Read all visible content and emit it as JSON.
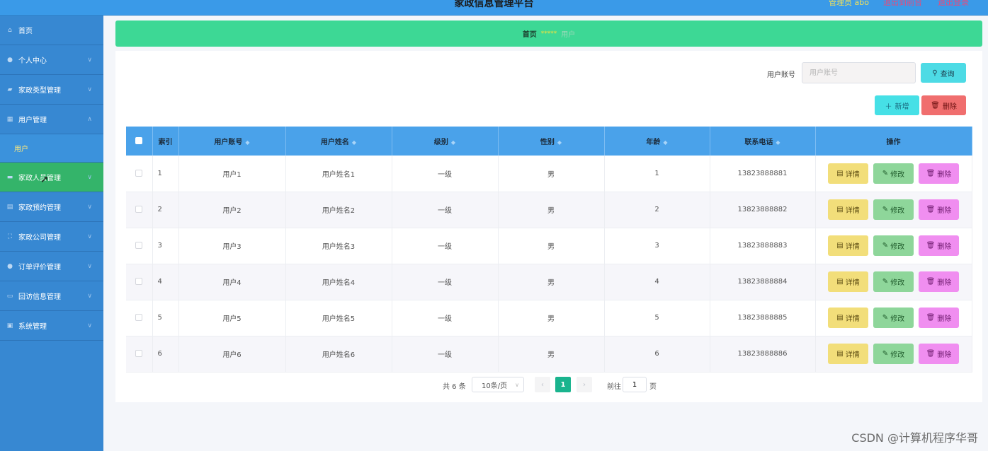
{
  "topbar": {
    "title": "家政信息管理平台",
    "user": "管理员 abo",
    "link_center": "退出到前台",
    "link_logout": "退出登录"
  },
  "sidebar": {
    "items": [
      {
        "label": "首页",
        "icon": "home-icon",
        "chev": false
      },
      {
        "label": "个人中心",
        "icon": "user-icon",
        "chev": true
      },
      {
        "label": "家政类型管理",
        "icon": "thumb-icon",
        "chev": true
      },
      {
        "label": "用户管理",
        "icon": "grid-icon",
        "chev": true,
        "expanded": true
      },
      {
        "label": "家政人员管理",
        "icon": "list-icon",
        "chev": true,
        "active": true
      },
      {
        "label": "家政预约管理",
        "icon": "clipboard-icon",
        "chev": true
      },
      {
        "label": "家政公司管理",
        "icon": "building-icon",
        "chev": true
      },
      {
        "label": "订单评价管理",
        "icon": "person-icon",
        "chev": true
      },
      {
        "label": "回访信息管理",
        "icon": "chat-icon",
        "chev": true
      },
      {
        "label": "系统管理",
        "icon": "settings-icon",
        "chev": true
      }
    ],
    "sub_item": "用户"
  },
  "breadcrumb": {
    "home": "首页",
    "stars": "*****",
    "page": "用户"
  },
  "search": {
    "label": "用户账号",
    "placeholder": "用户账号",
    "query_label": "查询"
  },
  "actions": {
    "add_label": "新增",
    "delete_label": "删除"
  },
  "table": {
    "headers": [
      "索引",
      "用户账号",
      "用户姓名",
      "级别",
      "性别",
      "年龄",
      "联系电话",
      "操作"
    ],
    "rows": [
      {
        "index": "1",
        "account": "用户1",
        "name": "用户姓名1",
        "level": "一级",
        "gender": "男",
        "age": "1",
        "phone": "13823888881"
      },
      {
        "index": "2",
        "account": "用户2",
        "name": "用户姓名2",
        "level": "一级",
        "gender": "男",
        "age": "2",
        "phone": "13823888882"
      },
      {
        "index": "3",
        "account": "用户3",
        "name": "用户姓名3",
        "level": "一级",
        "gender": "男",
        "age": "3",
        "phone": "13823888883"
      },
      {
        "index": "4",
        "account": "用户4",
        "name": "用户姓名4",
        "level": "一级",
        "gender": "男",
        "age": "4",
        "phone": "13823888884"
      },
      {
        "index": "5",
        "account": "用户5",
        "name": "用户姓名5",
        "level": "一级",
        "gender": "男",
        "age": "5",
        "phone": "13823888885"
      },
      {
        "index": "6",
        "account": "用户6",
        "name": "用户姓名6",
        "level": "一级",
        "gender": "男",
        "age": "6",
        "phone": "13823888886"
      }
    ],
    "op_detail": "详情",
    "op_edit": "修改",
    "op_delete": "删除"
  },
  "pager": {
    "total": "共 6 条",
    "page_size": "10条/页",
    "current": "1",
    "goto_label": "前往",
    "goto_value": "1",
    "page_unit": "页"
  },
  "watermark": "CSDN @计算机程序华哥",
  "colors": {
    "sidebar": "#3788d2",
    "active": "#34b46a",
    "breadcrumb": "#3dd895",
    "table_header": "#4aa2ea"
  }
}
